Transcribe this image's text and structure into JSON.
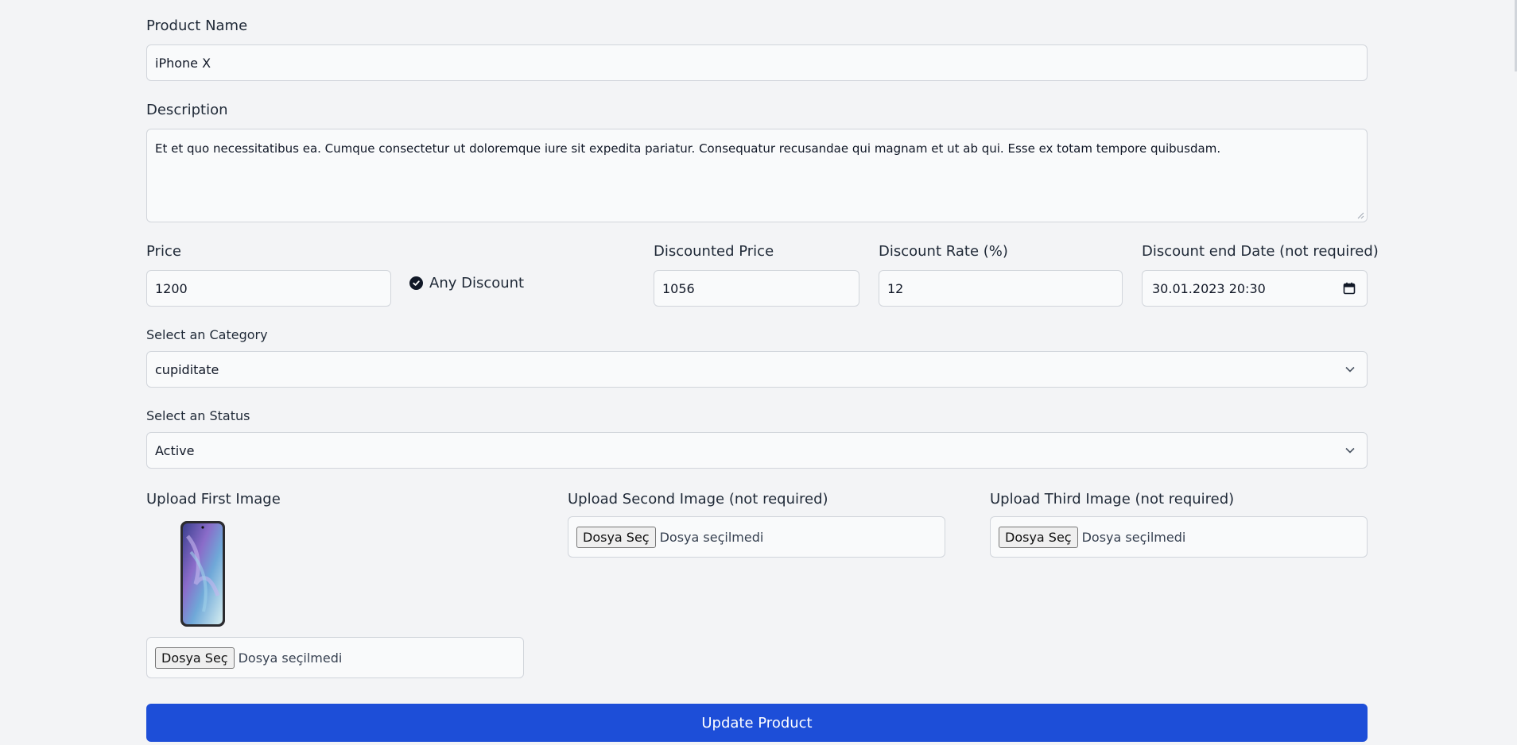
{
  "product_name": {
    "label": "Product Name",
    "value": "iPhone X"
  },
  "description": {
    "label": "Description",
    "value": "Et et quo necessitatibus ea. Cumque consectetur ut doloremque iure sit expedita pariatur. Consequatur recusandae qui magnam et ut ab qui. Esse ex totam tempore quibusdam."
  },
  "price": {
    "label": "Price",
    "value": "1200"
  },
  "any_discount": {
    "label": "Any Discount",
    "checked": true
  },
  "discounted_price": {
    "label": "Discounted Price",
    "value": "1056"
  },
  "discount_rate": {
    "label": "Discount Rate (%)",
    "value": "12"
  },
  "discount_end_date": {
    "label": "Discount end Date (not required)",
    "value": "30.01.2023 20:30"
  },
  "category": {
    "label": "Select an Category",
    "selected": "cupiditate"
  },
  "status": {
    "label": "Select an Status",
    "selected": "Active"
  },
  "first_image": {
    "label": "Upload First Image",
    "button": "Dosya Seç",
    "file_text": "Dosya seçilmedi"
  },
  "second_image": {
    "label": "Upload Second Image (not required)",
    "button": "Dosya Seç",
    "file_text": "Dosya seçilmedi"
  },
  "third_image": {
    "label": "Upload Third Image (not required)",
    "button": "Dosya Seç",
    "file_text": "Dosya seçilmedi"
  },
  "submit": {
    "label": "Update Product"
  },
  "colors": {
    "accent": "#1d4ed8",
    "background": "#f3f4f6",
    "input_bg": "#f9fafb",
    "border": "#d1d5db"
  }
}
